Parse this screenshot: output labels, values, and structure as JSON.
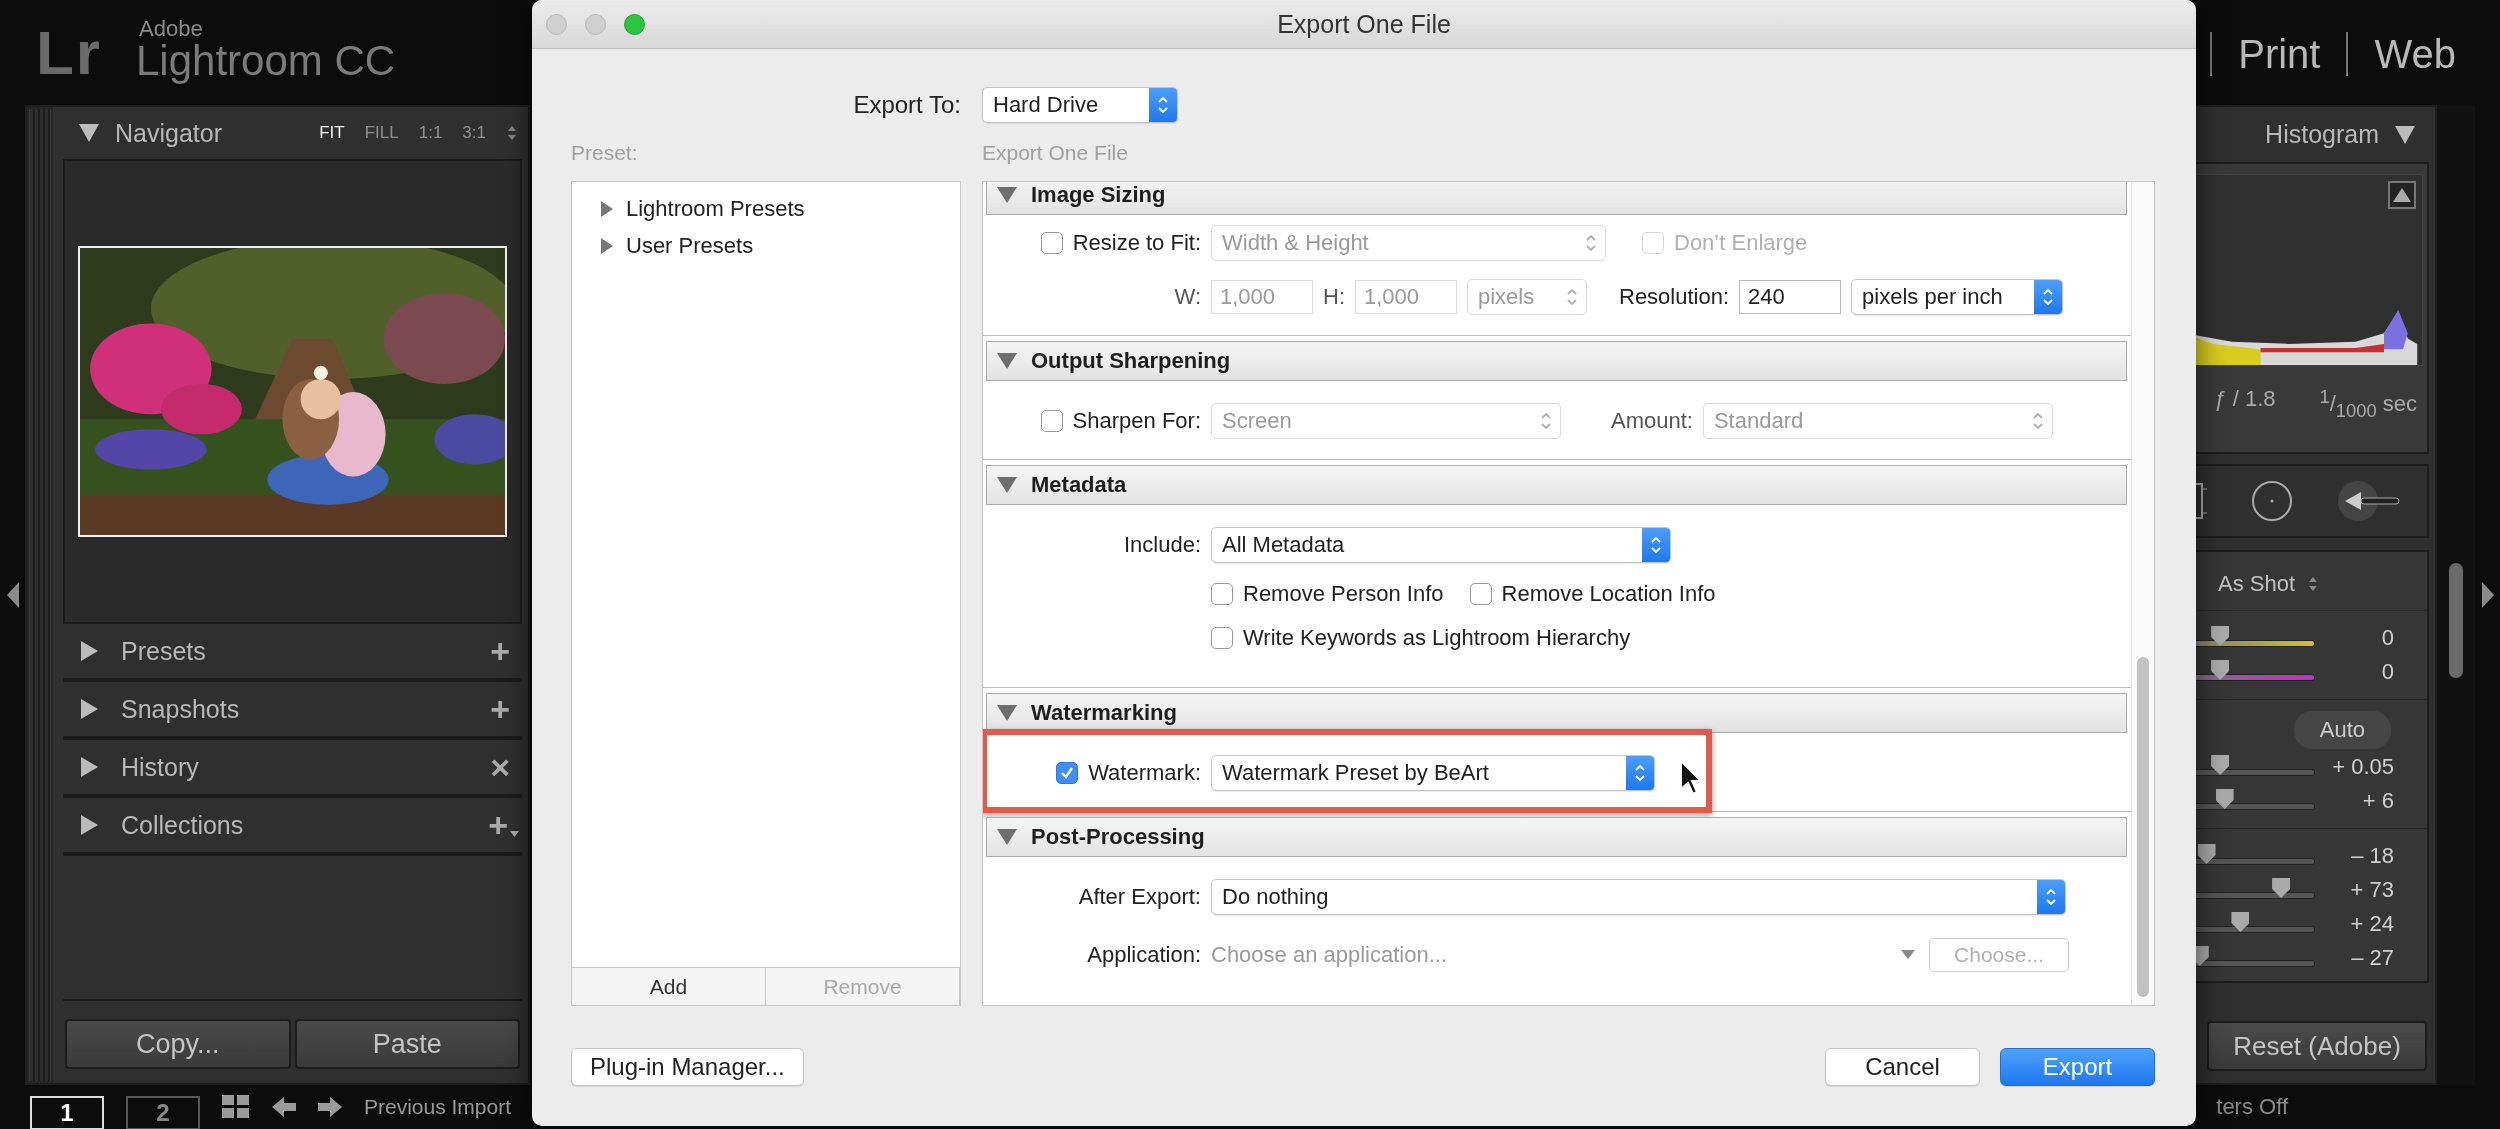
{
  "app": {
    "logo_mark": "Lr",
    "brand_small": "Adobe",
    "brand": "Lightroom CC",
    "modules": [
      "Print",
      "Web"
    ]
  },
  "left_panel": {
    "navigator": {
      "title": "Navigator",
      "expanded": true,
      "zoom_options": [
        {
          "label": "FIT",
          "selected": true
        },
        {
          "label": "FILL",
          "selected": false
        },
        {
          "label": "1:1",
          "selected": false
        },
        {
          "label": "3:1",
          "selected": false
        }
      ]
    },
    "panels": [
      {
        "title": "Presets",
        "expanded": false,
        "action": "+",
        "has_menu": false
      },
      {
        "title": "Snapshots",
        "expanded": false,
        "action": "+",
        "has_menu": false
      },
      {
        "title": "History",
        "expanded": false,
        "action": "×",
        "has_menu": false
      },
      {
        "title": "Collections",
        "expanded": false,
        "action": "+",
        "has_menu": true
      }
    ],
    "buttons": [
      "Copy...",
      "Paste"
    ]
  },
  "right_panel": {
    "title": "Histogram",
    "expanded": true,
    "aperture": "ƒ / 1.8",
    "shutter": "$^{1}$/$_{1000}$ sec",
    "white_balance": "As Shot",
    "wb_sliders": [
      {
        "kind": "temp",
        "level": 0.58,
        "value": "0"
      },
      {
        "kind": "tint",
        "level": 0.58,
        "value": "0"
      }
    ],
    "auto_button": "Auto",
    "tone_sliders": [
      {
        "kind": "plain",
        "level": 0.58,
        "value": "+ 0.05"
      },
      {
        "kind": "plain",
        "level": 0.6,
        "value": "+ 6"
      }
    ],
    "presence_sliders": [
      {
        "kind": "plain",
        "level": 0.52,
        "value": "– 18"
      },
      {
        "kind": "plain",
        "level": 0.85,
        "value": "+ 73"
      },
      {
        "kind": "plain",
        "level": 0.67,
        "value": "+ 24"
      },
      {
        "kind": "plain",
        "level": 0.49,
        "value": "– 27"
      }
    ],
    "reset_button": "Reset (Adobe)"
  },
  "bottom_bar": {
    "pages": [
      {
        "label": "1",
        "selected": true
      },
      {
        "label": "2",
        "selected": false
      }
    ],
    "source": "Previous Import",
    "filter": "ters Off"
  },
  "dialog": {
    "title": "Export One File",
    "export_to_label": "Export To:",
    "export_to": {
      "value": "Hard Drive",
      "disabled": false
    },
    "preset_label": "Preset:",
    "settings_label": "Export One File",
    "presets": [
      {
        "label": "Lightroom Presets",
        "expanded": false
      },
      {
        "label": "User Presets",
        "expanded": false
      }
    ],
    "preset_buttons": [
      {
        "label": "Add",
        "disabled": false
      },
      {
        "label": "Remove",
        "disabled": true
      }
    ],
    "sections": [
      {
        "kind": "image_sizing",
        "title": "Image Sizing",
        "expanded": true,
        "resize": {
          "label": "Resize to Fit:",
          "checked": false
        },
        "resize_mode": {
          "value": "Width & Height",
          "disabled": true
        },
        "enlarge": {
          "label": "Don’t Enlarge",
          "checked": false,
          "disabled": true
        },
        "width": {
          "label": "W:",
          "value": "1,000",
          "disabled": true
        },
        "height": {
          "label": "H:",
          "value": "1,000",
          "disabled": true
        },
        "units": {
          "value": "pixels",
          "disabled": true
        },
        "resolution_label": "Resolution:",
        "resolution": "240",
        "resolution_units": {
          "value": "pixels per inch",
          "disabled": false
        }
      },
      {
        "kind": "sharpening",
        "title": "Output Sharpening",
        "expanded": true,
        "sharpen": {
          "label": "Sharpen For:",
          "checked": false
        },
        "target": {
          "value": "Screen",
          "disabled": true
        },
        "amount_label": "Amount:",
        "amount": {
          "value": "Standard",
          "disabled": true
        }
      },
      {
        "kind": "metadata",
        "title": "Metadata",
        "expanded": true,
        "include_label": "Include:",
        "include": {
          "value": "All Metadata",
          "disabled": false
        },
        "options": [
          {
            "label": "Remove Person Info",
            "checked": false
          },
          {
            "label": "Remove Location Info",
            "checked": false
          },
          {
            "label": "Write Keywords as Lightroom Hierarchy",
            "checked": false
          }
        ]
      },
      {
        "kind": "watermarking",
        "title": "Watermarking",
        "expanded": true,
        "highlighted": true,
        "watermark": {
          "label": "Watermark:",
          "checked": true
        },
        "preset": {
          "value": "Watermark Preset by BeArt",
          "disabled": false
        }
      },
      {
        "kind": "post_processing",
        "title": "Post-Processing",
        "expanded": true,
        "after_export_label": "After Export:",
        "after_export": {
          "value": "Do nothing",
          "disabled": false
        },
        "application_label": "Application:",
        "application_placeholder": "Choose an application...",
        "choose_button": {
          "label": "Choose...",
          "disabled": true
        }
      }
    ],
    "footer": {
      "plugin_button": "Plug-in Manager...",
      "cancel": "Cancel",
      "export": "Export"
    }
  }
}
